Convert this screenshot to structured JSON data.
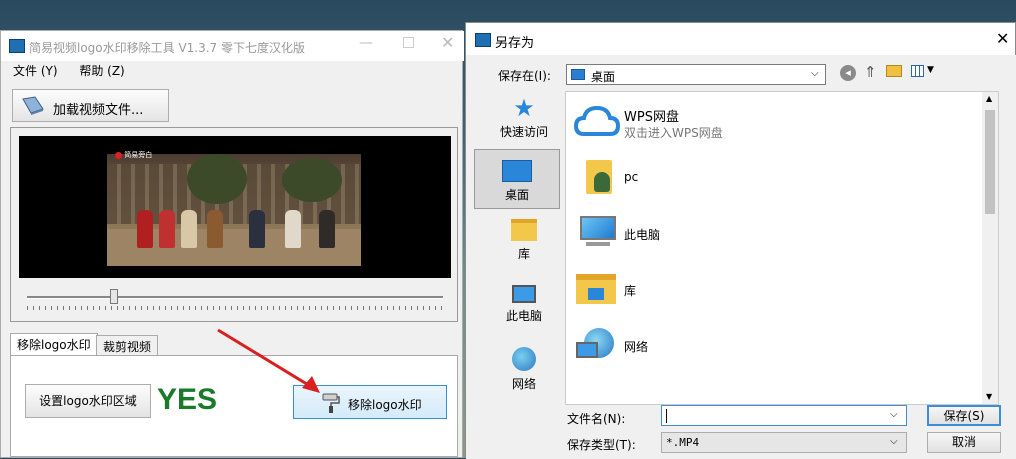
{
  "app": {
    "title": "简易视频logo水印移除工具 V1.3.7 零下七度汉化版",
    "menu": [
      "文件 (Y)",
      "帮助 (Z)"
    ],
    "load_button": "加载视频文件...",
    "video_overlay_text": "简易旁白",
    "tabs": [
      "移除logo水印",
      "裁剪视频"
    ],
    "set_area_button": "设置logo水印区域",
    "status_text": "YES",
    "remove_button": "移除logo水印",
    "seek_position": 0.21
  },
  "dialog": {
    "title": "另存为",
    "save_in_label": "保存在(I):",
    "save_in_value": "桌面",
    "places": [
      "快速访问",
      "桌面",
      "库",
      "此电脑",
      "网络"
    ],
    "files": [
      {
        "name": "WPS网盘",
        "desc": "双击进入WPS网盘",
        "icon": "cloud-icon"
      },
      {
        "name": "pc",
        "desc": "",
        "icon": "user-folder-icon"
      },
      {
        "name": "此电脑",
        "desc": "",
        "icon": "computer-icon"
      },
      {
        "name": "库",
        "desc": "",
        "icon": "library-folder-icon"
      },
      {
        "name": "网络",
        "desc": "",
        "icon": "network-icon"
      }
    ],
    "filename_label": "文件名(N):",
    "filename_value": "",
    "filetype_label": "保存类型(T):",
    "filetype_value": "*.MP4",
    "save_button": "保存(S)",
    "cancel_button": "取消"
  },
  "colors": {
    "accent": "#0078d7",
    "status_green": "#1a7a2a",
    "arrow_red": "#d92020"
  }
}
